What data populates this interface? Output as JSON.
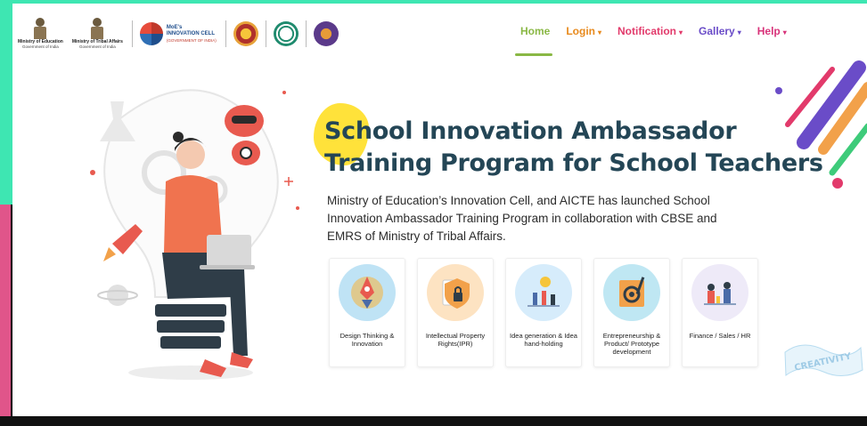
{
  "header": {
    "logos": {
      "ministry_education": {
        "line1": "Ministry of Education",
        "line2": "Government of India"
      },
      "ministry_tribal": {
        "line1": "Ministry of Tribal Affairs",
        "line2": "Government of India"
      },
      "moe_cell": {
        "line1": "MoE's",
        "line2": "INNOVATION CELL",
        "line3": "(GOVERNMENT OF INDIA)"
      }
    },
    "nav": {
      "home": "Home",
      "login": "Login",
      "notification": "Notification",
      "gallery": "Gallery",
      "help": "Help",
      "caret": "▾"
    }
  },
  "hero": {
    "title_line1": "School Innovation Ambassador",
    "title_line2": "Training Program for School Teachers",
    "description": "Ministry of Education’s Innovation Cell, and AICTE has launched School Innovation Ambassador Training Program in collaboration with CBSE and EMRS of Ministry of Tribal Affairs."
  },
  "cards": [
    {
      "label": "Design Thinking & Innovation",
      "icon": "rocket-icon"
    },
    {
      "label": "Intellectual Property Rights(IPR)",
      "icon": "ipr-shield-icon"
    },
    {
      "label": "Idea generation & Idea hand-holding",
      "icon": "idea-team-icon"
    },
    {
      "label": "Entrepreneurship & Product/ Prototype development",
      "icon": "blueprint-gear-icon"
    },
    {
      "label": "Finance / Sales / HR",
      "icon": "finance-team-icon"
    }
  ],
  "decor": {
    "creativity_text": "CREATIVITY"
  },
  "colors": {
    "title": "#244656",
    "home": "#8ab845",
    "login": "#e88a1d",
    "notification": "#e23a6b",
    "gallery": "#6a4cc8",
    "help": "#d8337a"
  }
}
